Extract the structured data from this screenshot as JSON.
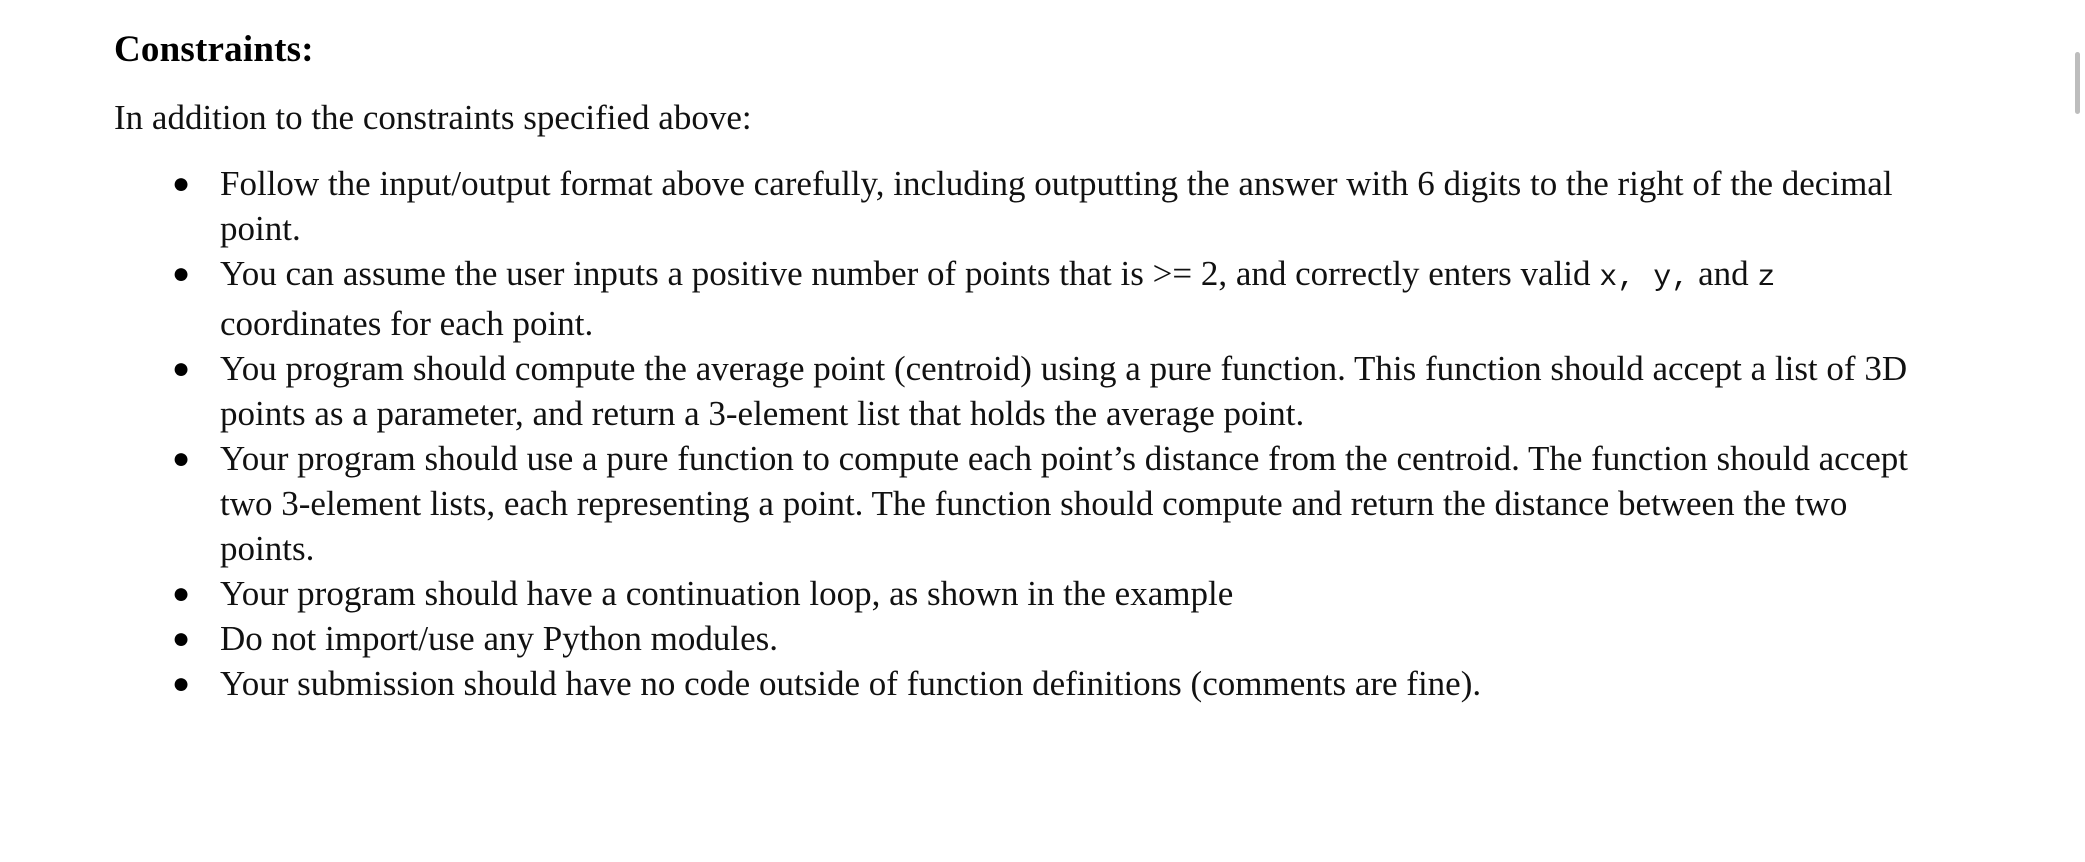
{
  "document": {
    "heading": "Constraints:",
    "intro": "In addition to the constraints specified above:",
    "bullet_glyph": "●",
    "constraints": [
      {
        "id": "io-format",
        "text": "Follow the input/output format above carefully, including outputting the answer with 6 digits to the right of the decimal point."
      },
      {
        "id": "valid-input-assumption",
        "text_before_code": "You can assume the user inputs a positive number of points that is >= 2, and correctly enters valid ",
        "code_x": "x, ",
        "code_y": "y,",
        "text_mid": " and ",
        "code_z": "z ",
        "text_after_code": " coordinates for each point."
      },
      {
        "id": "centroid-pure-function",
        "text": "You program should compute the average point (centroid) using a pure function. This function should accept a list of 3D points as a parameter, and return a 3-element list that holds the average point."
      },
      {
        "id": "distance-pure-function",
        "text": "Your program should use a pure function to compute each point’s distance from the centroid. The function should accept two 3-element lists, each representing a point. The function should compute and return the distance between the two points."
      },
      {
        "id": "continuation-loop",
        "text": "Your program should have a continuation loop, as shown in the example"
      },
      {
        "id": "no-modules",
        "text": "Do not import/use any Python modules."
      },
      {
        "id": "no-code-outside-functions",
        "text": "Your submission should have no code outside of function definitions (comments are fine)."
      }
    ]
  },
  "colors": {
    "text": "#111111",
    "background": "#ffffff",
    "scrollbar_thumb": "#bdbdbd"
  }
}
